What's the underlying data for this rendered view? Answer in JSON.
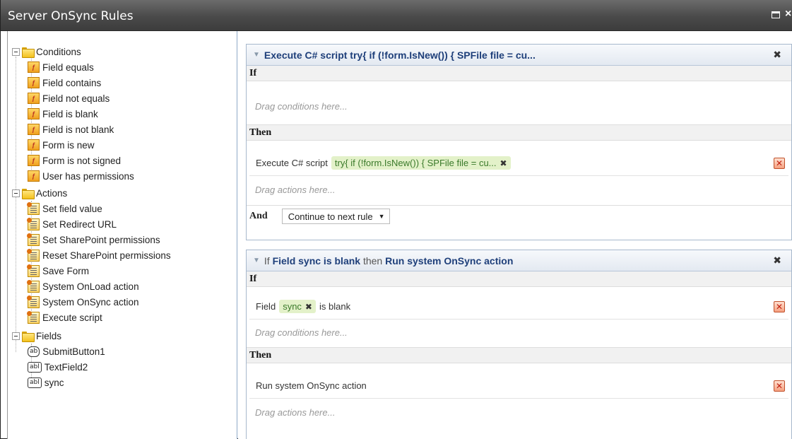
{
  "window": {
    "title": "Server OnSync Rules"
  },
  "tree": {
    "conditions": {
      "label": "Conditions",
      "items": [
        "Field equals",
        "Field contains",
        "Field not equals",
        "Field is blank",
        "Field is not blank",
        "Form is new",
        "Form is not signed",
        "User has permissions"
      ]
    },
    "actions": {
      "label": "Actions",
      "items": [
        "Set field value",
        "Set Redirect URL",
        "Set SharePoint permissions",
        "Reset SharePoint permissions",
        "Save Form",
        "System OnLoad action",
        "System OnSync action",
        "Execute script"
      ]
    },
    "fields": {
      "label": "Fields",
      "items": [
        {
          "label": "SubmitButton1",
          "icon": "ab"
        },
        {
          "label": "TextField2",
          "icon": "abl"
        },
        {
          "label": "sync",
          "icon": "abl"
        }
      ]
    }
  },
  "rule1": {
    "header_bold": "Execute C# script try{ if (!form.IsNew()) { SPFile file = cu...",
    "if_label": "If",
    "drag_conditions": "Drag conditions here...",
    "then_label": "Then",
    "action_text": "Execute C# script",
    "action_chip": "try{ if (!form.IsNew()) { SPFile file = cu...",
    "drag_actions": "Drag actions here...",
    "and_label": "And",
    "and_select": "Continue to next rule"
  },
  "rule2": {
    "header_if": "If",
    "header_cond": "Field sync is blank",
    "header_then": "then",
    "header_action": "Run system OnSync action",
    "if_label": "If",
    "cond_prefix": "Field",
    "cond_chip": "sync",
    "cond_suffix": "is blank",
    "drag_conditions": "Drag conditions here...",
    "then_label": "Then",
    "action_text": "Run system OnSync action",
    "drag_actions": "Drag actions here..."
  },
  "icons": {
    "condition": "condition-icon",
    "action": "action-script-icon",
    "folder": "folder-icon",
    "delete": "delete-icon"
  }
}
